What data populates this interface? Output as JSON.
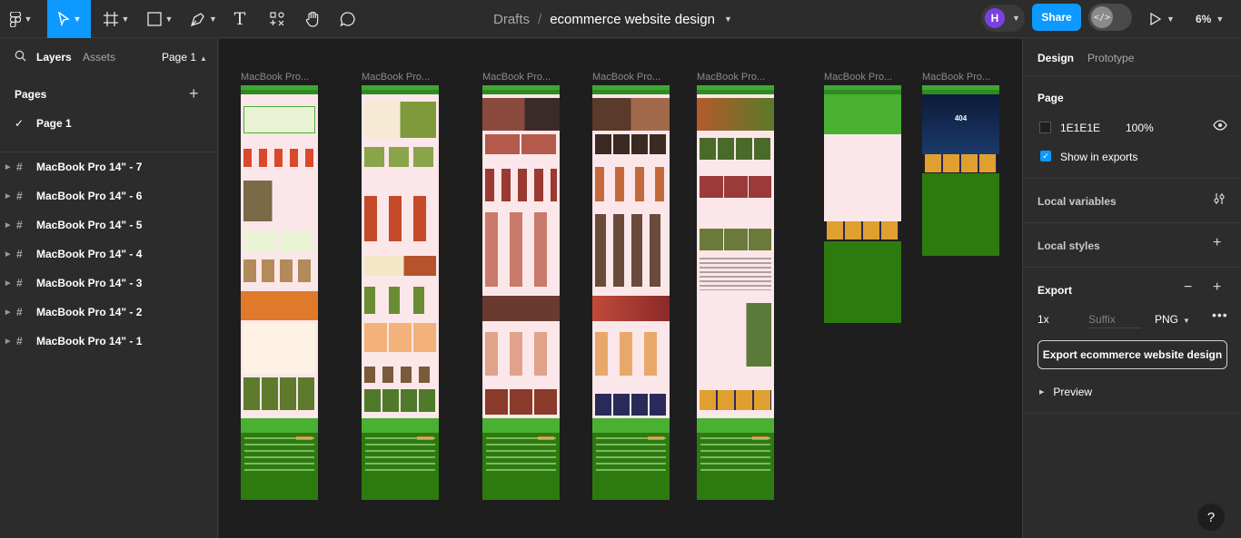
{
  "toolbar": {
    "main_menu_icon": "figma-icon",
    "move_tool_icon": "cursor-icon",
    "frame_tool_icon": "frame-icon",
    "shape_tool_icon": "rectangle-icon",
    "pen_tool_icon": "pen-icon",
    "text_tool_icon": "T",
    "actions_icon": "actions-icon",
    "hand_tool_icon": "hand-icon",
    "comment_icon": "comment-icon"
  },
  "breadcrumb": {
    "folder": "Drafts",
    "separator": "/",
    "file_title": "ecommerce website design"
  },
  "header": {
    "avatar_initial": "H",
    "share_label": "Share",
    "zoom_label": "6%",
    "accent_color": "#0d99ff",
    "avatar_color": "#7b3fe4"
  },
  "left_panel": {
    "tab_layers": "Layers",
    "tab_assets": "Assets",
    "page_selector": "Page 1",
    "pages_title": "Pages",
    "pages": [
      "Page 1"
    ],
    "layers": [
      "MacBook Pro 14\" - 7",
      "MacBook Pro 14\" - 6",
      "MacBook Pro 14\" - 5",
      "MacBook Pro 14\" - 4",
      "MacBook Pro 14\" - 3",
      "MacBook Pro 14\" - 2",
      "MacBook Pro 14\" - 1"
    ]
  },
  "canvas": {
    "background": "#1E1E1E",
    "frame_labels": [
      "MacBook Pro...",
      "MacBook Pro...",
      "MacBook Pro...",
      "MacBook Pro...",
      "MacBook Pro...",
      "MacBook Pro...",
      "MacBook Pro..."
    ],
    "frame_404_text": "404",
    "theme_colors": {
      "green": "#49b032",
      "dark_green": "#2d7b0e",
      "pink": "#fbe7e9",
      "orange": "#f07b24"
    }
  },
  "right_panel": {
    "tab_design": "Design",
    "tab_prototype": "Prototype",
    "page_section": "Page",
    "page_bg_hex": "1E1E1E",
    "page_bg_opacity": "100%",
    "show_in_exports": "Show in exports",
    "local_variables": "Local variables",
    "local_styles": "Local styles",
    "export_section": "Export",
    "export_scale": "1x",
    "export_suffix_placeholder": "Suffix",
    "export_format": "PNG",
    "export_button": "Export ecommerce website design",
    "preview_label": "Preview"
  },
  "help_label": "?"
}
